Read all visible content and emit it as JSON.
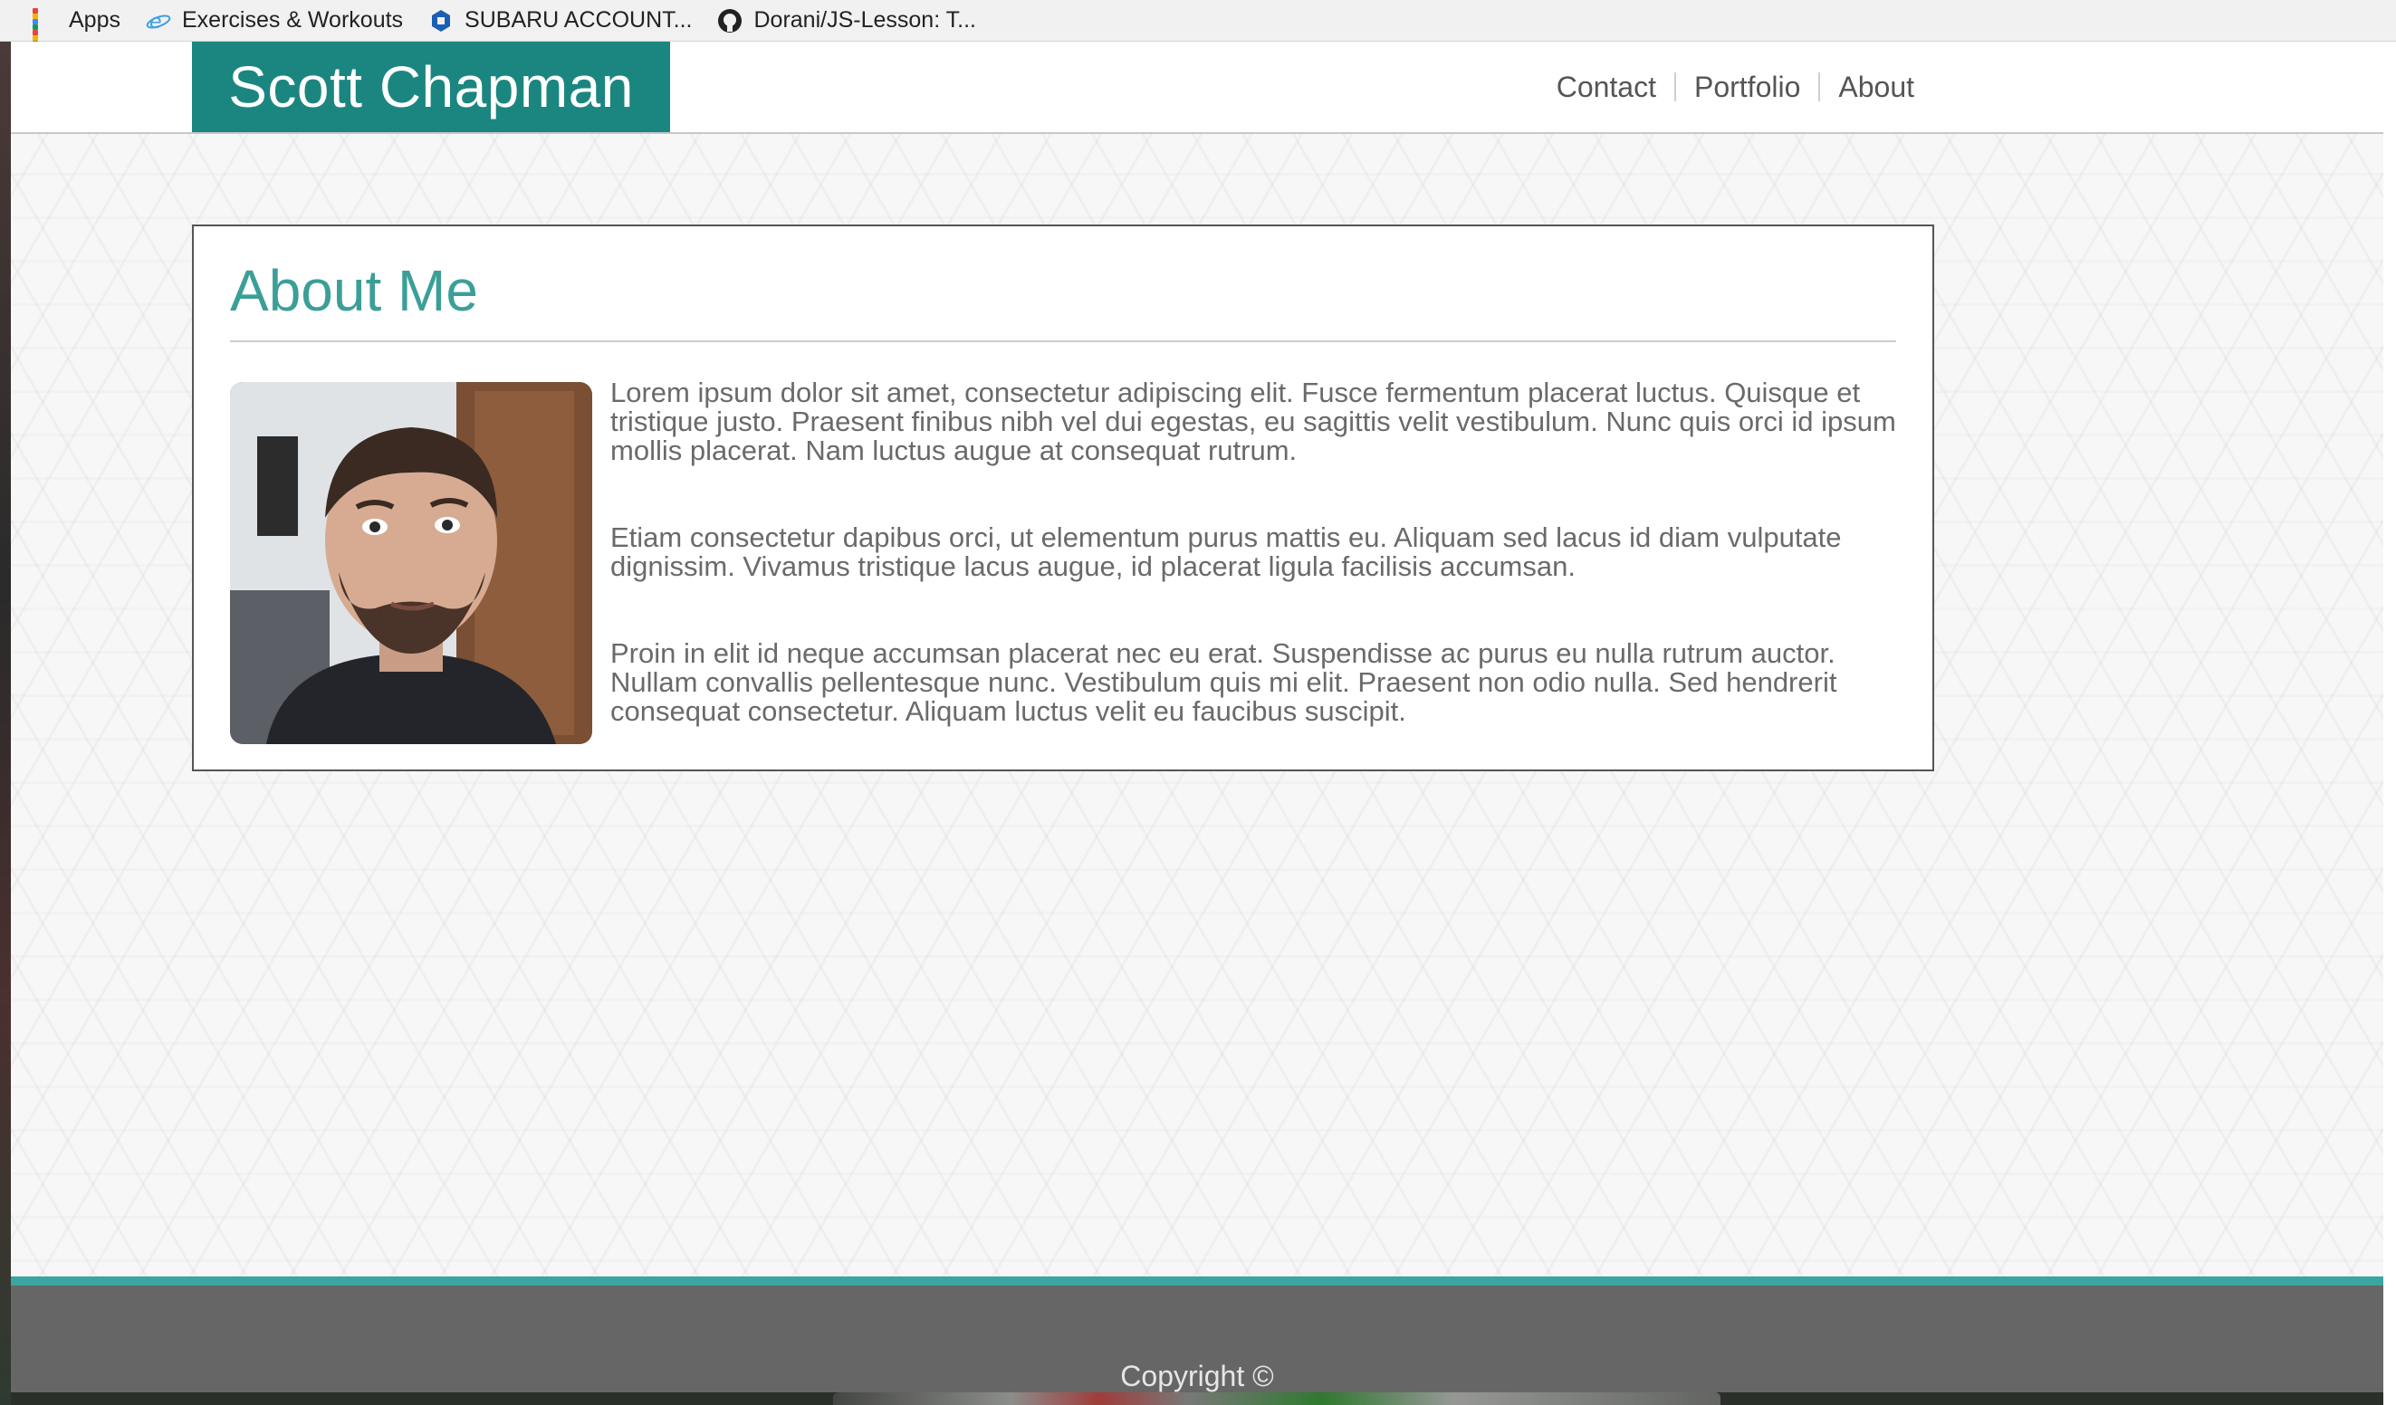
{
  "bookmarks": [
    {
      "label": "Apps",
      "icon": "apps-grid-icon"
    },
    {
      "label": "Exercises & Workouts",
      "icon": "ie-icon"
    },
    {
      "label": "SUBARU ACCOUNT...",
      "icon": "chase-icon"
    },
    {
      "label": "Dorani/JS-Lesson: T...",
      "icon": "github-icon"
    }
  ],
  "header": {
    "brand": "Scott Chapman",
    "nav": [
      "Contact",
      "Portfolio",
      "About"
    ]
  },
  "about": {
    "title": "About Me",
    "paragraphs": [
      "Lorem ipsum dolor sit amet, consectetur adipiscing elit. Fusce fermentum placerat luctus. Quisque et tristique justo. Praesent finibus nibh vel dui egestas, eu sagittis velit vestibulum. Nunc quis orci id ipsum mollis placerat. Nam luctus augue at consequat rutrum.",
      "Etiam consectetur dapibus orci, ut elementum purus mattis eu. Aliquam sed lacus id diam vulputate dignissim. Vivamus tristique lacus augue, id placerat ligula facilisis accumsan.",
      "Proin in elit id neque accumsan placerat nec eu erat. Suspendisse ac purus eu nulla rutrum auctor. Nullam convallis pellentesque nunc. Vestibulum quis mi elit. Praesent non odio nulla. Sed hendrerit consequat consectetur. Aliquam luctus velit eu faucibus suscipit."
    ]
  },
  "footer": {
    "copyright": "Copyright ©"
  },
  "colors": {
    "brand": "#1b8680",
    "heading": "#3b9f98",
    "footer": "#666666",
    "footer_accent": "#3aa69f"
  }
}
